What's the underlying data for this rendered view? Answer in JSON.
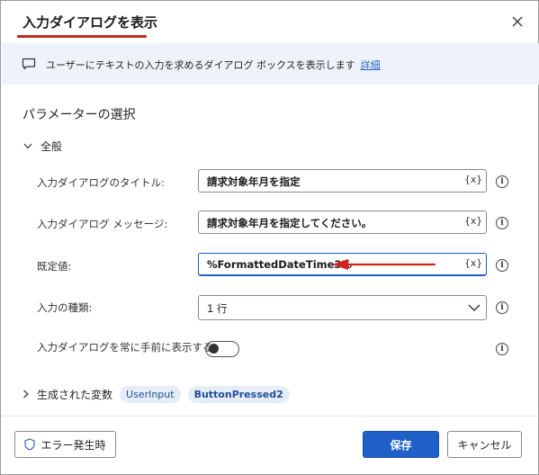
{
  "dialog": {
    "title": "入力ダイアログを表示",
    "banner": {
      "text": "ユーザーにテキストの入力を求めるダイアログ ボックスを表示します",
      "link": "詳細"
    },
    "section_title": "パラメーターの選択",
    "group": "全般",
    "fields": [
      {
        "label": "入力ダイアログのタイトル:",
        "value": "請求対象年月を指定",
        "var_button": "{x}"
      },
      {
        "label": "入力ダイアログ メッセージ:",
        "value": "請求対象年月を指定してください。",
        "var_button": "{x}"
      },
      {
        "label": "既定値:",
        "value": "%FormattedDateTime3%",
        "var_button": "{x}"
      }
    ],
    "input_type": {
      "label": "入力の種類:",
      "value": "1 行"
    },
    "always_on_top": {
      "label": "入力ダイアログを常に手前に表示する:",
      "checked": false
    },
    "generated_vars": {
      "label": "生成された変数",
      "vars": [
        "UserInput",
        "ButtonPressed2"
      ]
    },
    "info_glyph": "i",
    "buttons": {
      "error": "エラー発生時",
      "save": "保存",
      "cancel": "キャンセル"
    },
    "colors": {
      "accent": "#1f5fc8",
      "title_underline": "#c42b1c",
      "annotation_arrow": "#d3231f",
      "banner_bg": "#eef3fb"
    }
  }
}
